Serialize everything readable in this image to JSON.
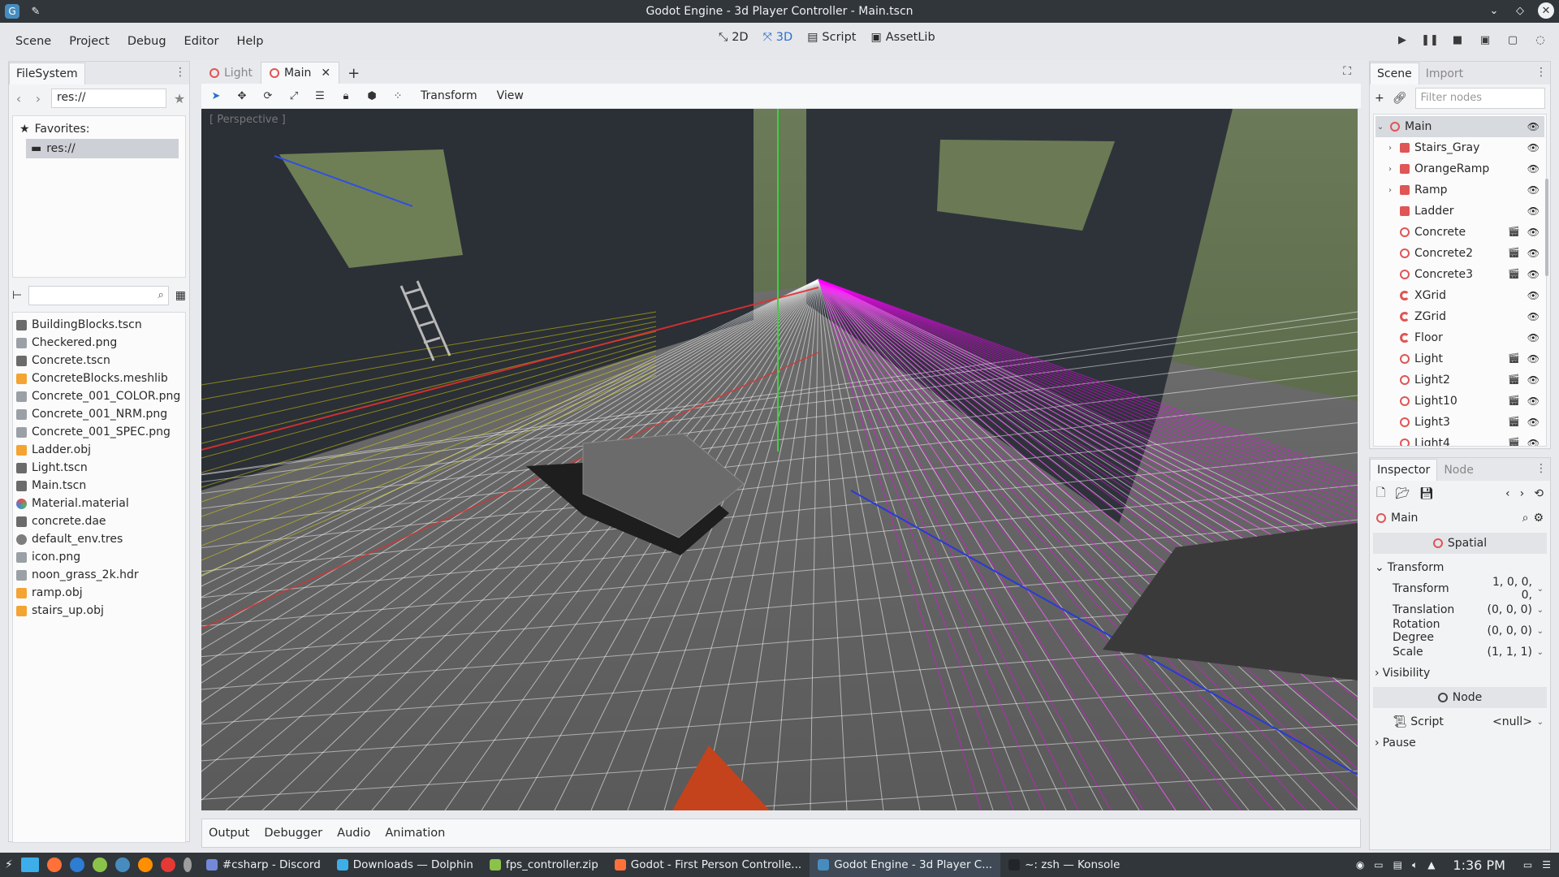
{
  "window": {
    "title": "Godot Engine - 3d Player Controller - Main.tscn"
  },
  "menu": [
    "Scene",
    "Project",
    "Debug",
    "Editor",
    "Help"
  ],
  "workspaces": [
    {
      "label": "2D",
      "icon": "2d-icon"
    },
    {
      "label": "3D",
      "icon": "3d-icon",
      "active": true
    },
    {
      "label": "Script",
      "icon": "script-icon"
    },
    {
      "label": "AssetLib",
      "icon": "assetlib-icon"
    }
  ],
  "filesystem": {
    "tab": "FileSystem",
    "path": "res://",
    "favorites_label": "Favorites:",
    "favorite_selected": "res://",
    "files": [
      {
        "name": "BuildingBlocks.tscn",
        "icon": "scene"
      },
      {
        "name": "Checkered.png",
        "icon": "img"
      },
      {
        "name": "Concrete.tscn",
        "icon": "scene"
      },
      {
        "name": "ConcreteBlocks.meshlib",
        "icon": "mesh"
      },
      {
        "name": "Concrete_001_COLOR.png",
        "icon": "img"
      },
      {
        "name": "Concrete_001_NRM.png",
        "icon": "img"
      },
      {
        "name": "Concrete_001_SPEC.png",
        "icon": "img"
      },
      {
        "name": "Ladder.obj",
        "icon": "mesh"
      },
      {
        "name": "Light.tscn",
        "icon": "scene"
      },
      {
        "name": "Main.tscn",
        "icon": "scene"
      },
      {
        "name": "Material.material",
        "icon": "mat"
      },
      {
        "name": "concrete.dae",
        "icon": "scene"
      },
      {
        "name": "default_env.tres",
        "icon": "env"
      },
      {
        "name": "icon.png",
        "icon": "img"
      },
      {
        "name": "noon_grass_2k.hdr",
        "icon": "img"
      },
      {
        "name": "ramp.obj",
        "icon": "mesh"
      },
      {
        "name": "stairs_up.obj",
        "icon": "mesh"
      }
    ]
  },
  "editor_tabs": [
    {
      "label": "Light",
      "active": false
    },
    {
      "label": "Main",
      "active": true
    }
  ],
  "viewport_menus": [
    "Transform",
    "View"
  ],
  "viewport_label": "[ Perspective ]",
  "bottom_tabs": [
    "Output",
    "Debugger",
    "Audio",
    "Animation"
  ],
  "scene_dock": {
    "tabs": [
      "Scene",
      "Import"
    ],
    "filter_placeholder": "Filter nodes",
    "nodes": [
      {
        "name": "Main",
        "type": "spatial",
        "arrow": "v",
        "level": 0,
        "selected": true,
        "scene": false
      },
      {
        "name": "Stairs_Gray",
        "type": "mesh",
        "arrow": ">",
        "level": 1,
        "scene": false
      },
      {
        "name": "OrangeRamp",
        "type": "mesh",
        "arrow": ">",
        "level": 1,
        "scene": false
      },
      {
        "name": "Ramp",
        "type": "mesh",
        "arrow": ">",
        "level": 1,
        "scene": false
      },
      {
        "name": "Ladder",
        "type": "mesh",
        "arrow": "",
        "level": 1,
        "scene": false
      },
      {
        "name": "Concrete",
        "type": "spatial",
        "arrow": "",
        "level": 1,
        "scene": true
      },
      {
        "name": "Concrete2",
        "type": "spatial",
        "arrow": "",
        "level": 1,
        "scene": true
      },
      {
        "name": "Concrete3",
        "type": "spatial",
        "arrow": "",
        "level": 1,
        "scene": true
      },
      {
        "name": "XGrid",
        "type": "grid",
        "arrow": "",
        "level": 1,
        "scene": false
      },
      {
        "name": "ZGrid",
        "type": "grid",
        "arrow": "",
        "level": 1,
        "scene": false
      },
      {
        "name": "Floor",
        "type": "grid",
        "arrow": "",
        "level": 1,
        "scene": false
      },
      {
        "name": "Light",
        "type": "spatial",
        "arrow": "",
        "level": 1,
        "scene": true
      },
      {
        "name": "Light2",
        "type": "spatial",
        "arrow": "",
        "level": 1,
        "scene": true
      },
      {
        "name": "Light10",
        "type": "spatial",
        "arrow": "",
        "level": 1,
        "scene": true
      },
      {
        "name": "Light3",
        "type": "spatial",
        "arrow": "",
        "level": 1,
        "scene": true
      },
      {
        "name": "Light4",
        "type": "spatial",
        "arrow": "",
        "level": 1,
        "scene": true
      }
    ]
  },
  "inspector": {
    "tabs": [
      "Inspector",
      "Node"
    ],
    "object": "Main",
    "section_spatial": "Spatial",
    "group_transform": "Transform",
    "props": [
      {
        "name": "Transform",
        "value": "1, 0, 0, 0,"
      },
      {
        "name": "Translation",
        "value": "(0, 0, 0)"
      },
      {
        "name": "Rotation Degree",
        "value": "(0, 0, 0)"
      },
      {
        "name": "Scale",
        "value": "(1, 1, 1)"
      }
    ],
    "group_visibility": "Visibility",
    "section_node": "Node",
    "script_name": "Script",
    "script_value": "<null>",
    "group_pause": "Pause"
  },
  "taskbar": {
    "tasks": [
      {
        "label": "#csharp - Discord",
        "color": "#7289da",
        "active": false
      },
      {
        "label": "Downloads — Dolphin",
        "color": "#3daee9",
        "active": false
      },
      {
        "label": "fps_controller.zip",
        "color": "#8bc34a",
        "active": false
      },
      {
        "label": "Godot - First Person Controlle...",
        "color": "#ff7139",
        "active": false
      },
      {
        "label": "Godot Engine - 3d Player C...",
        "color": "#478cbf",
        "active": true
      },
      {
        "label": "~: zsh — Konsole",
        "color": "#232629",
        "active": false
      }
    ],
    "clock": "1:36 PM"
  },
  "colors": {
    "accent": "#2a6fd1",
    "node_red": "#e05555",
    "grid_magenta": "#ff00ff",
    "grid_yellow": "#e8e000"
  }
}
